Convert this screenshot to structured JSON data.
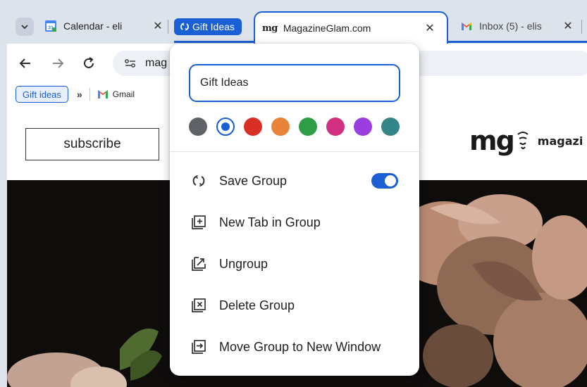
{
  "tabs": [
    {
      "title": "Calendar - eli",
      "favicon": "calendar-icon",
      "favicon_number": "31"
    },
    {
      "title": "MagazineGlam.com",
      "favicon": "mg-logo",
      "favicon_text": "mg",
      "active": true
    },
    {
      "title": "Inbox (5) - elis",
      "favicon": "gmail-icon"
    }
  ],
  "tab_group": {
    "label": "Gift Ideas",
    "color": "#1a5fd4"
  },
  "toolbar": {
    "url_partial": "mag"
  },
  "bookmarks": {
    "chip_label": "Gift ideas",
    "more": "»",
    "gmail_label": "Gmail"
  },
  "page": {
    "subscribe_label": "subscribe",
    "brand_logo": "mg",
    "brand_name": "magazi"
  },
  "popup": {
    "group_name_value": "Gift Ideas",
    "colors": [
      {
        "name": "grey",
        "hex": "#5f6368"
      },
      {
        "name": "blue",
        "hex": "#1a5fd4",
        "selected": true
      },
      {
        "name": "red",
        "hex": "#d93025"
      },
      {
        "name": "orange",
        "hex": "#e8833a"
      },
      {
        "name": "green",
        "hex": "#2e9d46"
      },
      {
        "name": "pink",
        "hex": "#d0307f"
      },
      {
        "name": "purple",
        "hex": "#9b3ee0"
      },
      {
        "name": "cyan",
        "hex": "#348587"
      }
    ],
    "menu": [
      {
        "label": "Save Group",
        "icon": "save-group-icon",
        "toggle_on": true
      },
      {
        "label": "New Tab in Group",
        "icon": "new-tab-icon"
      },
      {
        "label": "Ungroup",
        "icon": "ungroup-icon"
      },
      {
        "label": "Delete Group",
        "icon": "delete-group-icon"
      },
      {
        "label": "Move Group to New Window",
        "icon": "move-window-icon"
      }
    ]
  }
}
